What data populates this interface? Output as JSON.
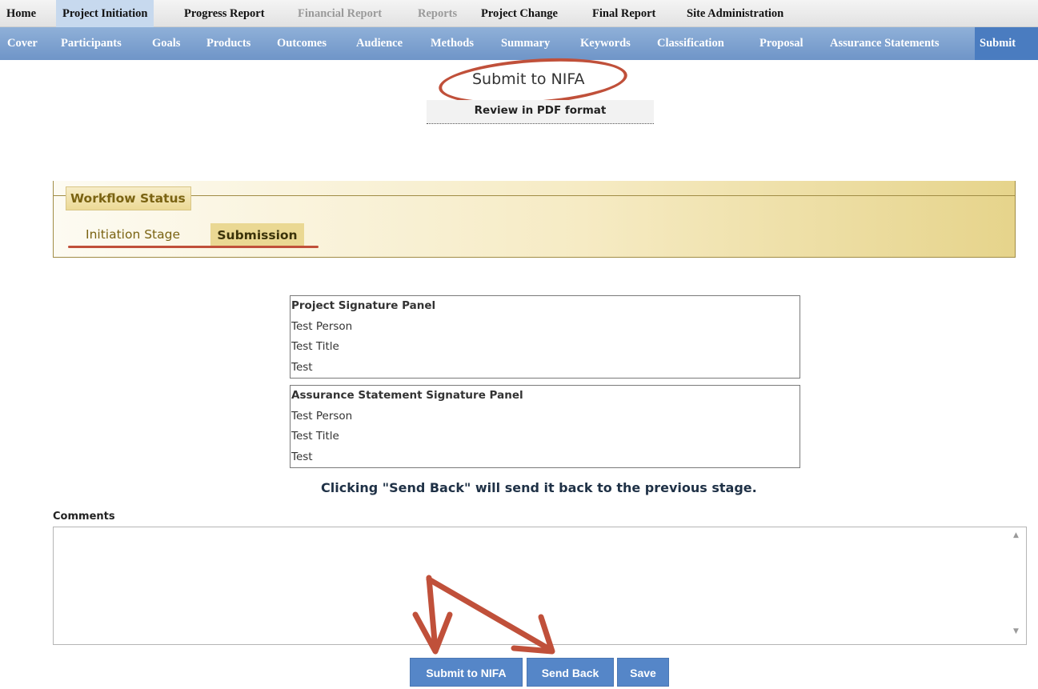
{
  "top_nav": [
    {
      "label": "Home",
      "state": "normal"
    },
    {
      "label": "Project Initiation",
      "state": "active"
    },
    {
      "label": "Progress Report",
      "state": "normal"
    },
    {
      "label": "Financial Report",
      "state": "disabled"
    },
    {
      "label": "Reports",
      "state": "disabled"
    },
    {
      "label": "Project Change",
      "state": "normal"
    },
    {
      "label": "Final Report",
      "state": "normal"
    },
    {
      "label": "Site Administration",
      "state": "normal"
    }
  ],
  "sub_nav": [
    {
      "label": "Cover"
    },
    {
      "label": "Participants"
    },
    {
      "label": "Goals"
    },
    {
      "label": "Products"
    },
    {
      "label": "Outcomes"
    },
    {
      "label": "Audience"
    },
    {
      "label": "Methods"
    },
    {
      "label": "Summary"
    },
    {
      "label": "Keywords"
    },
    {
      "label": "Classification"
    },
    {
      "label": "Proposal"
    },
    {
      "label": "Assurance Statements"
    },
    {
      "label": "Submit",
      "active": true
    }
  ],
  "page": {
    "heading": "Submit to NIFA",
    "review_link": "Review in PDF format"
  },
  "workflow": {
    "legend": "Workflow Status",
    "stages": [
      "Initiation Stage",
      "Submission"
    ],
    "current_stage": "Submission"
  },
  "panels": {
    "project": {
      "title": "Project Signature Panel",
      "rows": [
        "Test Person",
        "Test Title",
        "Test"
      ]
    },
    "assurance": {
      "title": "Assurance Statement Signature Panel",
      "rows": [
        "Test Person",
        "Test Title",
        "Test"
      ]
    }
  },
  "note": "Clicking \"Send Back\" will send it back to the previous stage.",
  "comments": {
    "label": "Comments",
    "value": ""
  },
  "buttons": {
    "submit": "Submit to NIFA",
    "send_back": "Send Back",
    "save": "Save"
  },
  "colors": {
    "annotation": "#c0503a",
    "button": "#5586c8",
    "subnav": "#6f95c8"
  }
}
